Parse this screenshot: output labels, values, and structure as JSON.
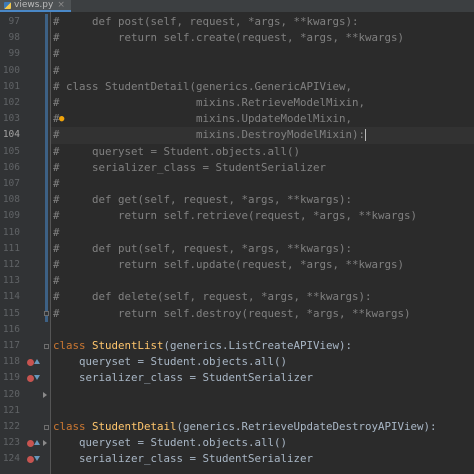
{
  "tab": {
    "label": "views.py",
    "icon": "python-file-icon"
  },
  "colors": {
    "background": "#2b2b2b",
    "gutter": "#313335",
    "keyword": "#cc7832",
    "function_name": "#ffc66d",
    "comment": "#808080",
    "text": "#a9b7c6",
    "line_number": "#606366"
  },
  "editor": {
    "current_line": "104",
    "lines": [
      {
        "n": "97",
        "tokens": [
          [
            "cm",
            "#     def post(self, request, *args, **kwargs):"
          ]
        ]
      },
      {
        "n": "98",
        "tokens": [
          [
            "cm",
            "#         return self.create(request, *args, **kwargs)"
          ]
        ]
      },
      {
        "n": "99",
        "tokens": [
          [
            "cm",
            "#"
          ]
        ]
      },
      {
        "n": "100",
        "tokens": [
          [
            "cm",
            "#"
          ]
        ]
      },
      {
        "n": "101",
        "tokens": [
          [
            "cm",
            "# class StudentDetail(generics.GenericAPIView,"
          ]
        ]
      },
      {
        "n": "102",
        "tokens": [
          [
            "cm",
            "#                     mixins.RetrieveModelMixin,"
          ]
        ]
      },
      {
        "n": "103",
        "tokens": [
          [
            "cm",
            "#                     mixins.UpdateModelMixin,"
          ]
        ]
      },
      {
        "n": "104",
        "tokens": [
          [
            "cm",
            "#                     mixins.DestroyModelMixin):"
          ]
        ]
      },
      {
        "n": "105",
        "tokens": [
          [
            "cm",
            "#     queryset = Student.objects.all()"
          ]
        ]
      },
      {
        "n": "106",
        "tokens": [
          [
            "cm",
            "#     serializer_class = StudentSerializer"
          ]
        ]
      },
      {
        "n": "107",
        "tokens": [
          [
            "cm",
            "#"
          ]
        ]
      },
      {
        "n": "108",
        "tokens": [
          [
            "cm",
            "#     def get(self, request, *args, **kwargs):"
          ]
        ]
      },
      {
        "n": "109",
        "tokens": [
          [
            "cm",
            "#         return self.retrieve(request, *args, **kwargs)"
          ]
        ]
      },
      {
        "n": "110",
        "tokens": [
          [
            "cm",
            "#"
          ]
        ]
      },
      {
        "n": "111",
        "tokens": [
          [
            "cm",
            "#     def put(self, request, *args, **kwargs):"
          ]
        ]
      },
      {
        "n": "112",
        "tokens": [
          [
            "cm",
            "#         return self.update(request, *args, **kwargs)"
          ]
        ]
      },
      {
        "n": "113",
        "tokens": [
          [
            "cm",
            "#"
          ]
        ]
      },
      {
        "n": "114",
        "tokens": [
          [
            "cm",
            "#     def delete(self, request, *args, **kwargs):"
          ]
        ]
      },
      {
        "n": "115",
        "tokens": [
          [
            "cm",
            "#         return self.destroy(request, *args, **kwargs)"
          ]
        ]
      },
      {
        "n": "116",
        "tokens": []
      },
      {
        "n": "117",
        "tokens": [
          [
            "kw",
            "class "
          ],
          [
            "fn",
            "StudentList"
          ],
          [
            "tx",
            "(generics.ListCreateAPIView):"
          ]
        ]
      },
      {
        "n": "118",
        "tokens": [
          [
            "tx",
            "    queryset = Student.objects.all()"
          ]
        ]
      },
      {
        "n": "119",
        "tokens": [
          [
            "tx",
            "    serializer_class = StudentSerializer"
          ]
        ]
      },
      {
        "n": "120",
        "tokens": []
      },
      {
        "n": "121",
        "tokens": []
      },
      {
        "n": "122",
        "tokens": [
          [
            "kw",
            "class "
          ],
          [
            "fn",
            "StudentDetail"
          ],
          [
            "tx",
            "(generics.RetrieveUpdateDestroyAPIView):"
          ]
        ]
      },
      {
        "n": "123",
        "tokens": [
          [
            "tx",
            "    queryset = Student.objects.all()"
          ]
        ]
      },
      {
        "n": "124",
        "tokens": [
          [
            "tx",
            "    serializer_class = StudentSerializer"
          ]
        ]
      }
    ]
  }
}
